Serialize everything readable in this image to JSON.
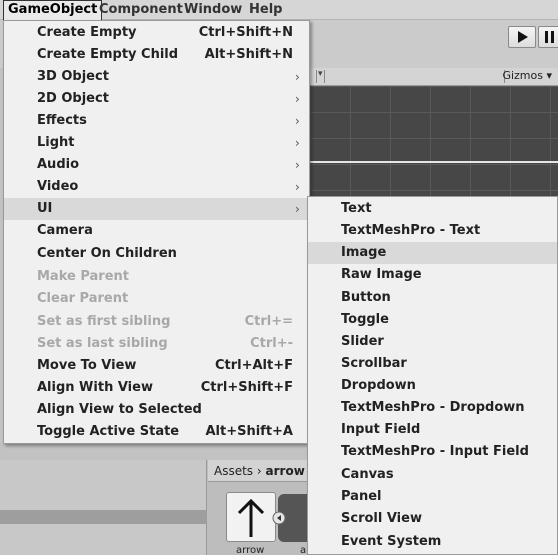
{
  "menubar": {
    "items": [
      {
        "label": "GameObject",
        "active": true
      },
      {
        "label": "Component",
        "active": false
      },
      {
        "label": "Window",
        "active": false
      },
      {
        "label": "Help",
        "active": false
      }
    ]
  },
  "scene": {
    "gizmos_label": "Gizmos ▾"
  },
  "project": {
    "breadcrumb_root": "Assets",
    "breadcrumb_sep": "›",
    "breadcrumb_current": "arrow",
    "asset_label_1": "arrow",
    "asset_label_2": "a"
  },
  "gameobject_menu": {
    "items": [
      {
        "label": "Create Empty",
        "shortcut": "Ctrl+Shift+N",
        "submenu": false,
        "disabled": false
      },
      {
        "label": "Create Empty Child",
        "shortcut": "Alt+Shift+N",
        "submenu": false,
        "disabled": false
      },
      {
        "label": "3D Object",
        "shortcut": "",
        "submenu": true,
        "disabled": false
      },
      {
        "label": "2D Object",
        "shortcut": "",
        "submenu": true,
        "disabled": false
      },
      {
        "label": "Effects",
        "shortcut": "",
        "submenu": true,
        "disabled": false
      },
      {
        "label": "Light",
        "shortcut": "",
        "submenu": true,
        "disabled": false
      },
      {
        "label": "Audio",
        "shortcut": "",
        "submenu": true,
        "disabled": false
      },
      {
        "label": "Video",
        "shortcut": "",
        "submenu": true,
        "disabled": false
      },
      {
        "label": "UI",
        "shortcut": "",
        "submenu": true,
        "disabled": false,
        "highlighted": true
      },
      {
        "label": "Camera",
        "shortcut": "",
        "submenu": false,
        "disabled": false
      },
      {
        "label": "Center On Children",
        "shortcut": "",
        "submenu": false,
        "disabled": false
      },
      {
        "label": "Make Parent",
        "shortcut": "",
        "submenu": false,
        "disabled": true
      },
      {
        "label": "Clear Parent",
        "shortcut": "",
        "submenu": false,
        "disabled": true
      },
      {
        "label": "Set as first sibling",
        "shortcut": "Ctrl+=",
        "submenu": false,
        "disabled": true
      },
      {
        "label": "Set as last sibling",
        "shortcut": "Ctrl+-",
        "submenu": false,
        "disabled": true
      },
      {
        "label": "Move To View",
        "shortcut": "Ctrl+Alt+F",
        "submenu": false,
        "disabled": false
      },
      {
        "label": "Align With View",
        "shortcut": "Ctrl+Shift+F",
        "submenu": false,
        "disabled": false
      },
      {
        "label": "Align View to Selected",
        "shortcut": "",
        "submenu": false,
        "disabled": false
      },
      {
        "label": "Toggle Active State",
        "shortcut": "Alt+Shift+A",
        "submenu": false,
        "disabled": false
      }
    ],
    "submenu_arrow": "›"
  },
  "ui_submenu": {
    "items": [
      {
        "label": "Text"
      },
      {
        "label": "TextMeshPro - Text"
      },
      {
        "label": "Image",
        "highlighted": true
      },
      {
        "label": "Raw Image"
      },
      {
        "label": "Button"
      },
      {
        "label": "Toggle"
      },
      {
        "label": "Slider"
      },
      {
        "label": "Scrollbar"
      },
      {
        "label": "Dropdown"
      },
      {
        "label": "TextMeshPro - Dropdown"
      },
      {
        "label": "Input Field"
      },
      {
        "label": "TextMeshPro - Input Field"
      },
      {
        "label": "Canvas"
      },
      {
        "label": "Panel"
      },
      {
        "label": "Scroll View"
      },
      {
        "label": "Event System"
      }
    ]
  }
}
